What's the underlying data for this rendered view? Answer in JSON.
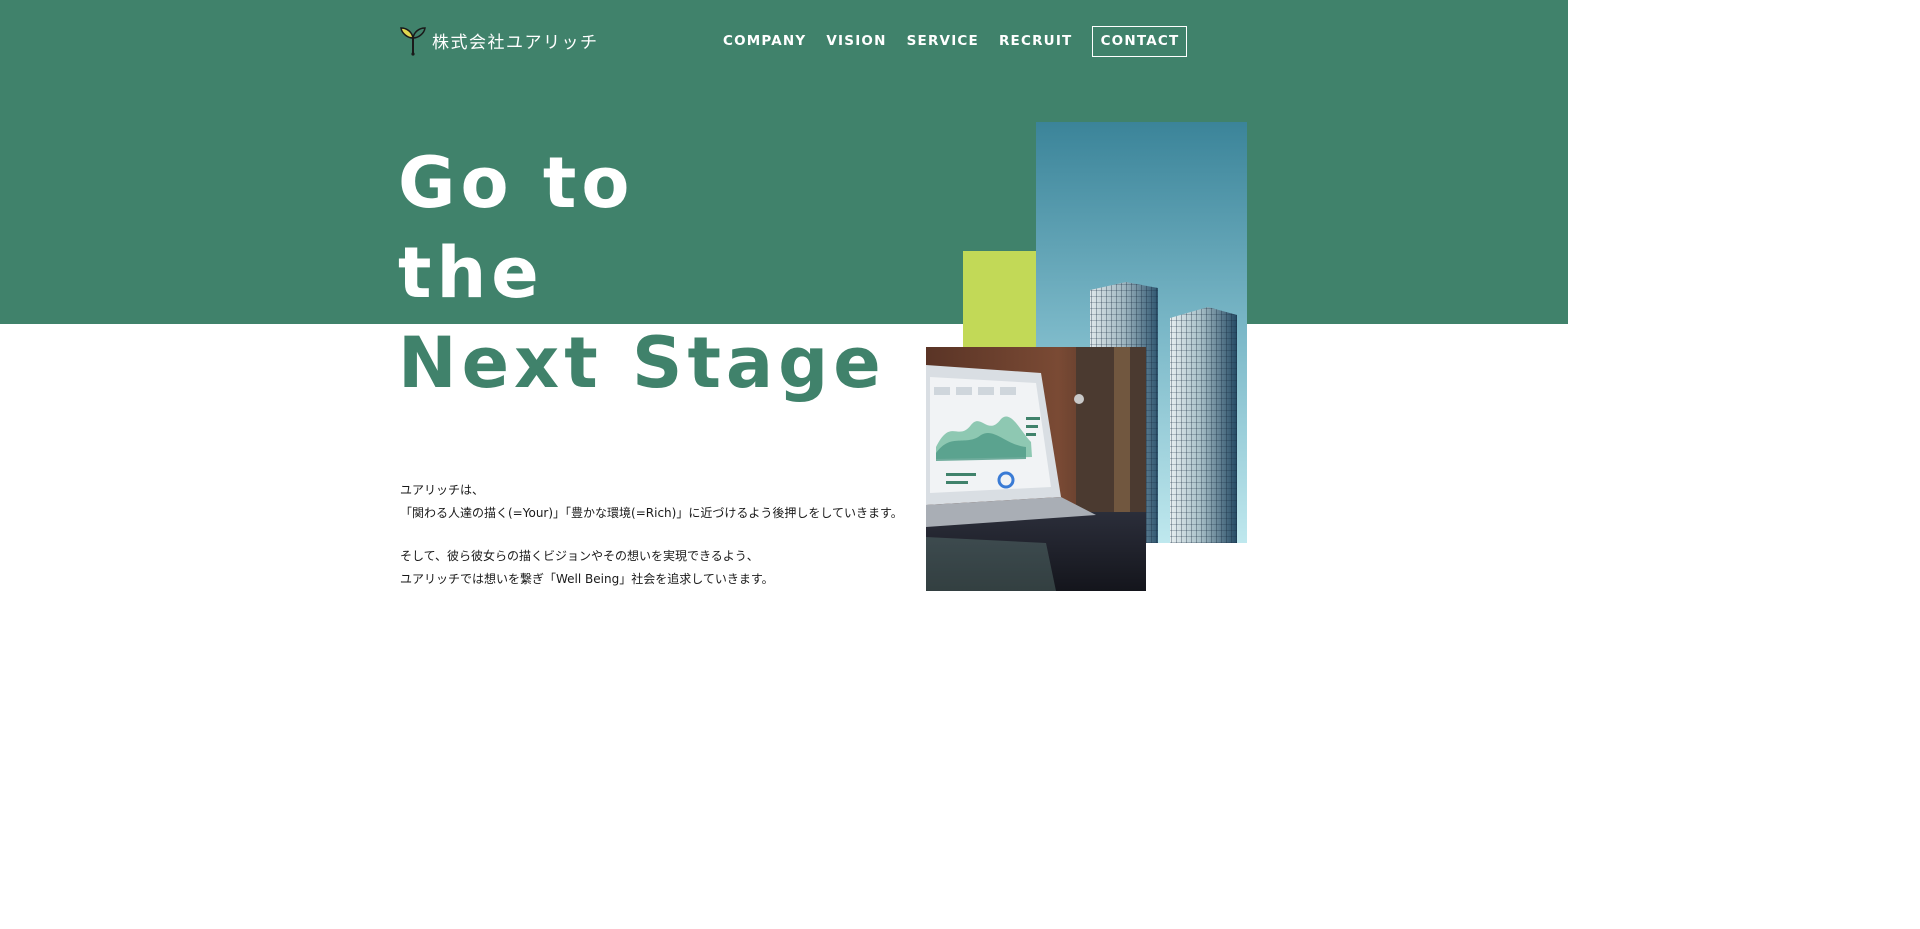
{
  "header": {
    "logo_text": "株式会社ユアリッチ",
    "nav": [
      "COMPANY",
      "VISION",
      "SERVICE",
      "RECRUIT"
    ],
    "contact_label": "CONTACT"
  },
  "hero": {
    "line1": "Go to",
    "line2": "the",
    "line3": "Next Stage"
  },
  "description": {
    "p1_line1": "ユアリッチは、",
    "p1_line2": "「関わる人達の描く(=Your)」「豊かな環境(=Rich)」に近づけるよう後押しをしていきます。",
    "p2_line1": "そして、彼ら彼女らの描くビジョンやその想いを実現できるよう、",
    "p2_line2": "ユアリッチでは想いを繋ぎ「Well Being」社会を追求していきます。"
  },
  "colors": {
    "brand_green": "#40826b",
    "accent_lime": "#c2d957",
    "white": "#ffffff"
  },
  "icons": {
    "logo": "sprout-logo-icon"
  }
}
